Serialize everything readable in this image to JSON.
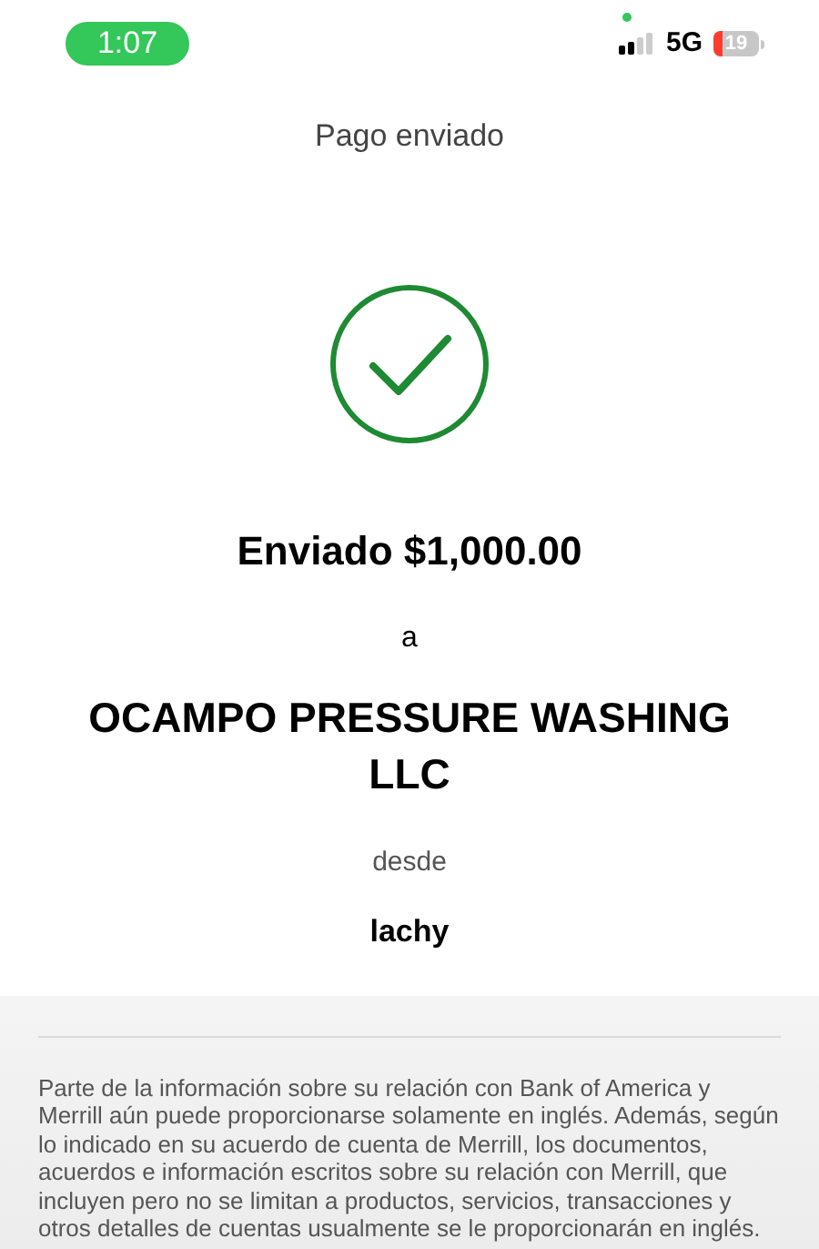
{
  "status_bar": {
    "time": "1:07",
    "network": "5G",
    "battery": "19"
  },
  "title": "Pago enviado",
  "amount_line": "Enviado $1,000.00",
  "to_label": "a",
  "recipient": "OCAMPO PRESSURE WASHING LLC",
  "from_label": "desde",
  "sender": "lachy",
  "disclaimer": "Parte de la información sobre su relación con Bank of America y Merrill aún puede proporcionarse solamente en inglés. Además, según lo indicado en su acuerdo de cuenta de Merrill, los documentos, acuerdos e información escritos sobre su relación con Merrill, que incluyen pero no se limitan a productos, servicios, transacciones y otros detalles de cuentas usualmente se le proporcionarán en inglés."
}
